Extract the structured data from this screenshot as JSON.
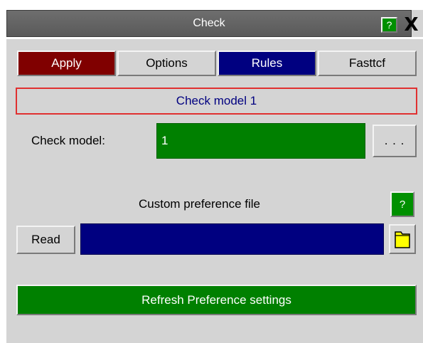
{
  "window": {
    "title": "Check",
    "help_label": "?",
    "close_label": "X"
  },
  "tabs": [
    {
      "label": "Apply",
      "color": "#800000"
    },
    {
      "label": "Options"
    },
    {
      "label": "Rules",
      "color": "#000080"
    },
    {
      "label": "Fasttcf"
    }
  ],
  "banner": {
    "text": "Check model 1",
    "border_color": "#e03030",
    "text_color": "#000080"
  },
  "check_model": {
    "label": "Check model:",
    "value": "1",
    "picker_label": ". . ."
  },
  "preference": {
    "label": "Custom preference file",
    "help_label": "?",
    "read_label": "Read",
    "file_value": "",
    "folder_icon": "folder-icon"
  },
  "refresh": {
    "label": "Refresh Preference settings"
  },
  "colors": {
    "panel": "#d4d4d4",
    "accent_green": "#008000",
    "accent_blue": "#000080"
  }
}
